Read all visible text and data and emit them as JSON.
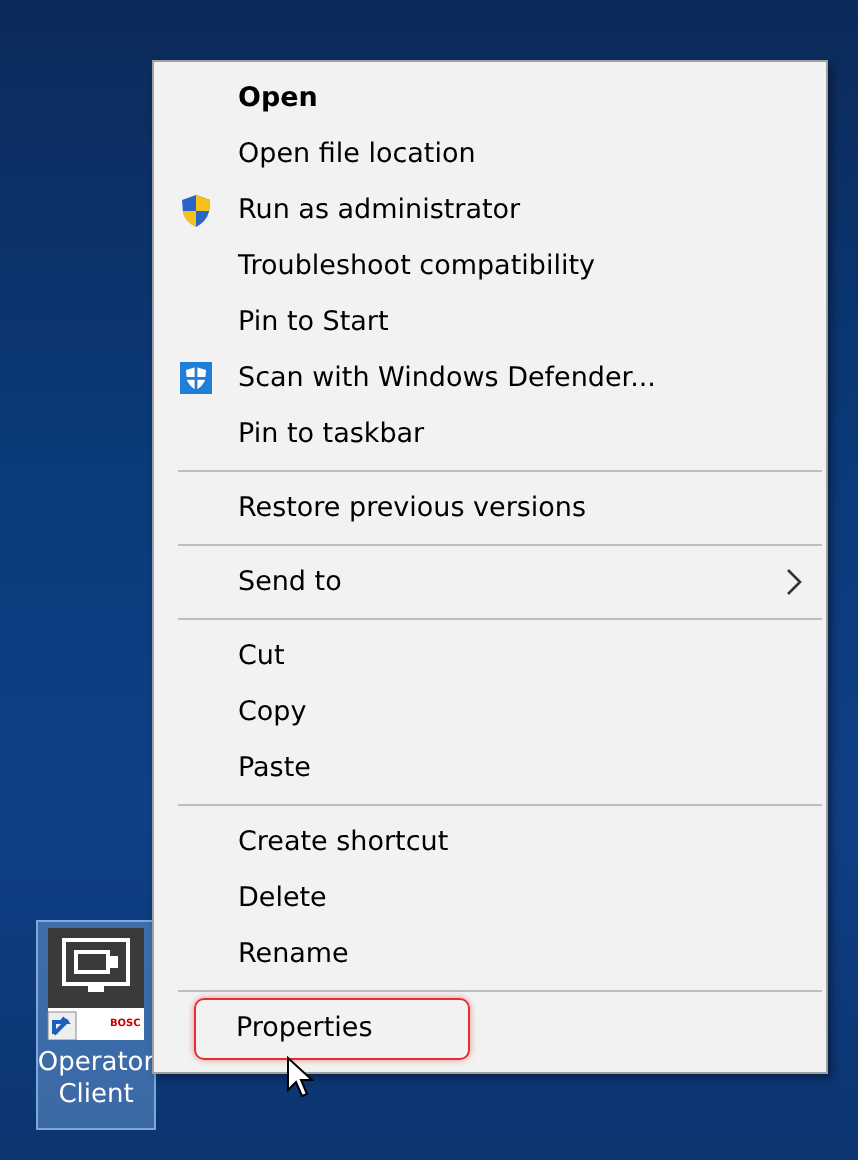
{
  "desktop_icon": {
    "label": "Operator Client",
    "logo_text": "BOSC",
    "selected": true
  },
  "context_menu": {
    "items": [
      {
        "kind": "item",
        "label": "Open",
        "default": true
      },
      {
        "kind": "item",
        "label": "Open file location"
      },
      {
        "kind": "uac",
        "label": "Run as administrator"
      },
      {
        "kind": "item",
        "label": "Troubleshoot compatibility"
      },
      {
        "kind": "item",
        "label": "Pin to Start"
      },
      {
        "kind": "antivirus",
        "label": "Scan with Windows Defender..."
      },
      {
        "kind": "item",
        "label": "Pin to taskbar"
      },
      {
        "kind": "separator"
      },
      {
        "kind": "item",
        "label": "Restore previous versions"
      },
      {
        "kind": "separator"
      },
      {
        "kind": "item",
        "label": "Send to",
        "submenu": true
      },
      {
        "kind": "separator"
      },
      {
        "kind": "item",
        "label": "Cut"
      },
      {
        "kind": "item",
        "label": "Copy"
      },
      {
        "kind": "item",
        "label": "Paste"
      },
      {
        "kind": "separator"
      },
      {
        "kind": "item",
        "label": "Create shortcut"
      },
      {
        "kind": "item",
        "label": "Delete"
      },
      {
        "kind": "item",
        "label": "Rename"
      },
      {
        "kind": "separator"
      },
      {
        "kind": "item",
        "label": "Properties",
        "highlighted": true
      }
    ]
  }
}
